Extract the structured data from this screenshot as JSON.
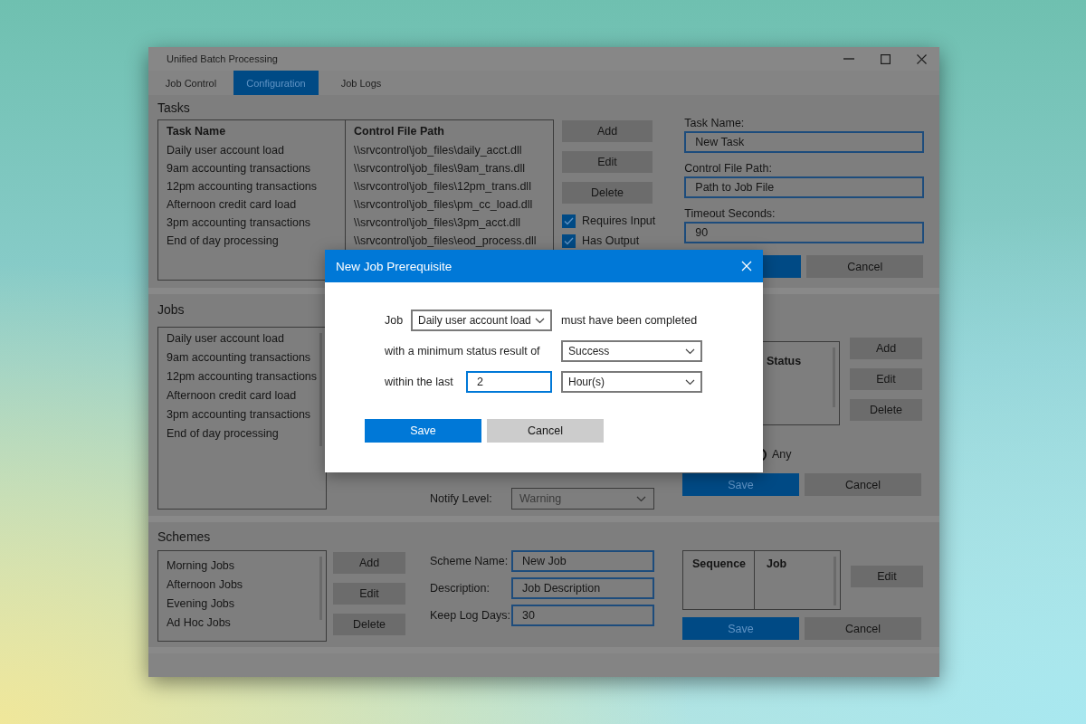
{
  "window": {
    "title": "Unified Batch Processing"
  },
  "tabs": [
    {
      "label": "Job Control",
      "selected": false
    },
    {
      "label": "Configuration",
      "selected": true
    },
    {
      "label": "Job Logs",
      "selected": false
    }
  ],
  "tasks": {
    "heading": "Tasks",
    "columns": [
      "Task Name",
      "Control File Path"
    ],
    "rows": [
      {
        "name": "Daily user account load",
        "path": "\\\\srvcontrol\\job_files\\daily_acct.dll"
      },
      {
        "name": "9am accounting transactions",
        "path": "\\\\srvcontrol\\job_files\\9am_trans.dll"
      },
      {
        "name": "12pm accounting transactions",
        "path": "\\\\srvcontrol\\job_files\\12pm_trans.dll"
      },
      {
        "name": "Afternoon credit card load",
        "path": "\\\\srvcontrol\\job_files\\pm_cc_load.dll"
      },
      {
        "name": "3pm accounting transactions",
        "path": "\\\\srvcontrol\\job_files\\3pm_acct.dll"
      },
      {
        "name": "End of day processing",
        "path": "\\\\srvcontrol\\job_files\\eod_process.dll"
      }
    ],
    "buttons": [
      "Add",
      "Edit",
      "Delete"
    ],
    "checkboxes": [
      {
        "label": "Requires Input",
        "checked": true
      },
      {
        "label": "Has Output",
        "checked": true
      }
    ],
    "fields": [
      {
        "label": "Task Name:",
        "value": "New Task"
      },
      {
        "label": "Control File Path:",
        "value": "Path to Job File"
      },
      {
        "label": "Timeout Seconds:",
        "value": "90"
      }
    ],
    "actions": [
      {
        "kind": "primary"
      },
      {
        "kind": "secondary",
        "label": "Cancel"
      }
    ]
  },
  "jobs": {
    "heading": "Jobs",
    "items": [
      "Daily user account load",
      "9am accounting transactions",
      "12pm accounting transactions",
      "Afternoon credit card load",
      "3pm accounting transactions",
      "End of day processing"
    ],
    "notify": {
      "label": "Notify Level:",
      "value": "Warning"
    },
    "prerequisites": {
      "columns": [
        "Status"
      ]
    },
    "buttons": [
      "Add",
      "Edit",
      "Delete"
    ],
    "radio": {
      "label": "Any",
      "selected": false
    },
    "actions": [
      {
        "kind": "primary",
        "label": "Save"
      },
      {
        "kind": "secondary",
        "label": "Cancel"
      }
    ]
  },
  "schemes": {
    "heading": "Schemes",
    "items": [
      "Morning Jobs",
      "Afternoon Jobs",
      "Evening Jobs",
      "Ad Hoc Jobs"
    ],
    "buttons": [
      "Add",
      "Edit",
      "Delete"
    ],
    "fields": [
      {
        "label": "Scheme Name:",
        "value": "New Job"
      },
      {
        "label": "Description:",
        "value": "Job Description"
      },
      {
        "label": "Keep Log Days:",
        "value": "30"
      }
    ],
    "sequence": {
      "columns": [
        "Sequence",
        "Job"
      ]
    },
    "edit_button": "Edit",
    "actions": [
      {
        "kind": "primary",
        "label": "Save"
      },
      {
        "kind": "secondary",
        "label": "Cancel"
      }
    ]
  },
  "dialog": {
    "title": "New Job Prerequisite",
    "job_label": "Job",
    "job_value": "Daily user account load",
    "job_suffix": "must have been completed",
    "status_label": "with a minimum status result of",
    "status_value": "Success",
    "within_label": "within the last",
    "within_value": "2",
    "unit_value": "Hour(s)",
    "actions": [
      {
        "kind": "primary",
        "label": "Save"
      },
      {
        "kind": "secondary",
        "label": "Cancel"
      }
    ]
  }
}
